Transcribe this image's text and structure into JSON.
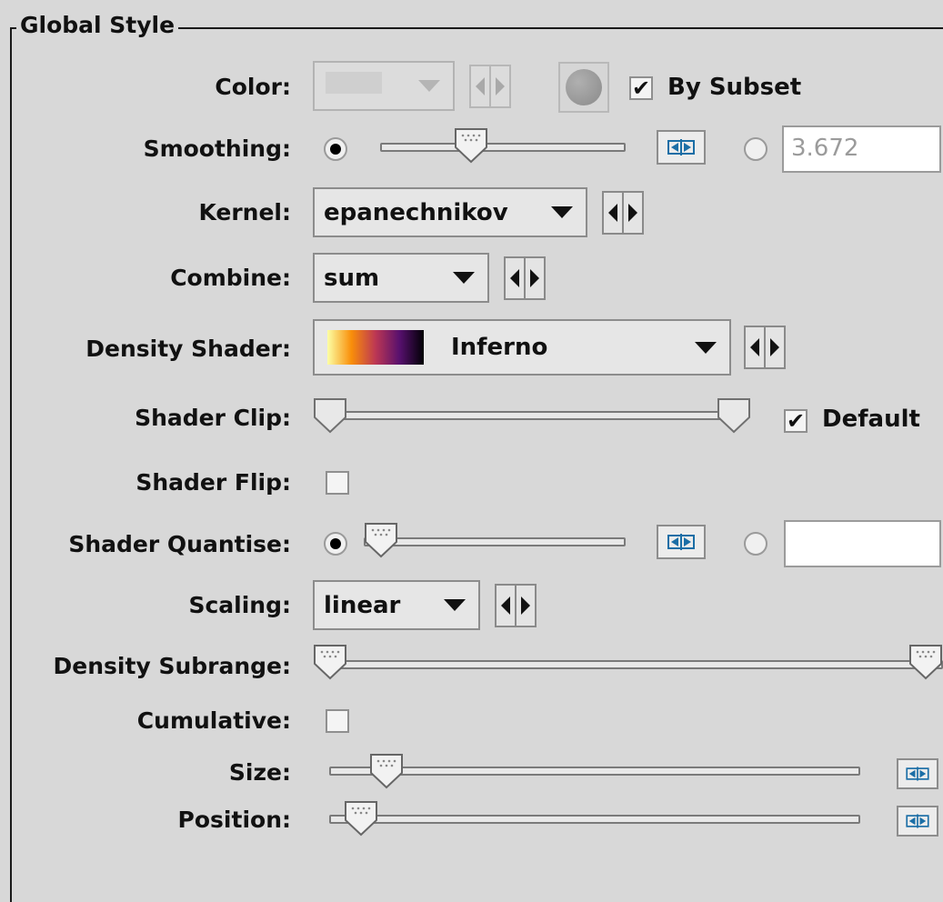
{
  "panel": {
    "title": "Global Style"
  },
  "color": {
    "label": "Color:",
    "by_subset_label": "By Subset",
    "by_subset_checked": true
  },
  "smoothing": {
    "label": "Smoothing:",
    "slider_position": 0.35,
    "radio_slider_selected": true,
    "value": "3.672"
  },
  "kernel": {
    "label": "Kernel:",
    "value": "epanechnikov"
  },
  "combine": {
    "label": "Combine:",
    "value": "sum"
  },
  "density_shader": {
    "label": "Density Shader:",
    "value": "Inferno",
    "gradient_colors": [
      "#fcffa4",
      "#f98e09",
      "#bc3754",
      "#57106e",
      "#000004"
    ]
  },
  "shader_clip": {
    "label": "Shader Clip:",
    "range": [
      0.0,
      1.0
    ],
    "default_label": "Default",
    "default_checked": true
  },
  "shader_flip": {
    "label": "Shader Flip:",
    "checked": false
  },
  "shader_quantise": {
    "label": "Shader Quantise:",
    "slider_position": 0.0,
    "radio_slider_selected": true,
    "value": ""
  },
  "scaling": {
    "label": "Scaling:",
    "value": "linear"
  },
  "density_subrange": {
    "label": "Density Subrange:",
    "range": [
      0.0,
      1.0
    ]
  },
  "cumulative": {
    "label": "Cumulative:",
    "checked": false
  },
  "size": {
    "label": "Size:",
    "slider_position": 0.08
  },
  "position": {
    "label": "Position:",
    "slider_position": 0.03
  }
}
